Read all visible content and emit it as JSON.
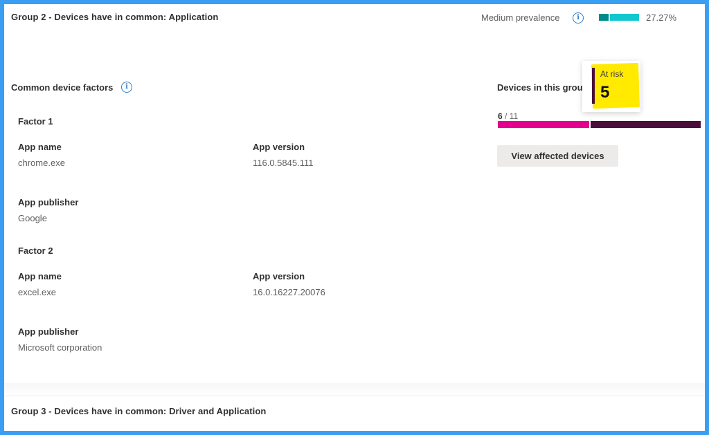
{
  "group2": {
    "title": "Group 2 - Devices have in common: Application",
    "prevalence_label": "Medium prevalence",
    "prevalence_percent": "27.27%",
    "prevalence_value": 0.2727,
    "prevalence_colors": {
      "dark": "#008b8b",
      "light": "#13c7d0"
    }
  },
  "common_factors": {
    "title": "Common device factors",
    "factors": [
      {
        "title": "Factor 1",
        "app_name_label": "App name",
        "app_name": "chrome.exe",
        "app_version_label": "App version",
        "app_version": "116.0.5845.111",
        "app_publisher_label": "App publisher",
        "app_publisher": "Google"
      },
      {
        "title": "Factor 2",
        "app_name_label": "App name",
        "app_name": "excel.exe",
        "app_version_label": "App version",
        "app_version": "16.0.16227.20076",
        "app_publisher_label": "App publisher",
        "app_publisher": "Microsoft corporation"
      }
    ]
  },
  "devices": {
    "title": "Devices in this group",
    "count_current": "6",
    "count_sep": " / ",
    "count_total": "11",
    "at_risk_fraction": 0.4545,
    "bar_colors": {
      "at_risk": "#e3008c",
      "other": "#4a0e3a"
    },
    "view_button": "View affected devices"
  },
  "tooltip": {
    "label": "At risk",
    "value": "5",
    "highlight_color": "#ffea00"
  },
  "group3": {
    "title": "Group 3 - Devices have in common: Driver and Application"
  },
  "icons": {
    "info": "info-icon"
  }
}
